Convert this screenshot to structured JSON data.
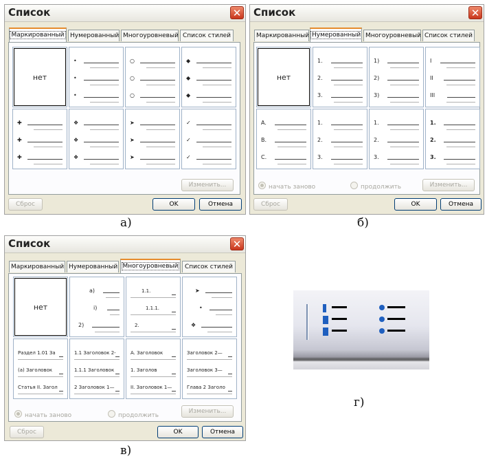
{
  "captions": {
    "a": "а)",
    "b": "б)",
    "v": "в)",
    "g": "г)"
  },
  "dialogs": [
    {
      "title": "Список",
      "tabs": [
        "Маркированный",
        "Нумерованный",
        "Многоуровневый",
        "Список стилей"
      ],
      "active_tab": 0,
      "cells": [
        {
          "none": "нет",
          "selected": true
        },
        {
          "markers": [
            "•",
            "•",
            "•"
          ]
        },
        {
          "markers": [
            "○",
            "○",
            "○"
          ]
        },
        {
          "markers": [
            "◆",
            "◆",
            "◆"
          ]
        },
        {
          "markers": [
            "✚",
            "✚",
            "✚"
          ]
        },
        {
          "markers": [
            "❖",
            "❖",
            "❖"
          ]
        },
        {
          "markers": [
            "➤",
            "➤",
            "➤"
          ]
        },
        {
          "markers": [
            "✓",
            "✓",
            "✓"
          ]
        }
      ],
      "change_label": "Изменить...",
      "reset_label": "Сброс",
      "ok_label": "OK",
      "cancel_label": "Отмена"
    },
    {
      "title": "Список",
      "tabs": [
        "Маркированный",
        "Нумерованный",
        "Многоуровневый",
        "Список стилей"
      ],
      "active_tab": 1,
      "cells": [
        {
          "none": "нет",
          "selected": true
        },
        {
          "markers": [
            "1.",
            "2.",
            "3."
          ]
        },
        {
          "markers": [
            "1)",
            "2)",
            "3)"
          ]
        },
        {
          "markers": [
            "I",
            "II",
            "III"
          ]
        },
        {
          "markers": [
            "A.",
            "B.",
            "C."
          ]
        },
        {
          "markers": [
            "1.",
            "2.",
            "3."
          ]
        },
        {
          "markers": [
            "1.",
            "2.",
            "3."
          ]
        },
        {
          "markers": [
            "1.",
            "2.",
            "3."
          ],
          "bold": true
        }
      ],
      "restart_label": "начать заново",
      "continue_label": "продолжить",
      "change_label": "Изменить...",
      "reset_label": "Сброс",
      "ok_label": "OK",
      "cancel_label": "Отмена"
    },
    {
      "title": "Список",
      "tabs": [
        "Маркированный",
        "Нумерованный",
        "Многоуровневый",
        "Список стилей"
      ],
      "active_tab": 2,
      "cells": [
        {
          "none": "нет",
          "selected": true
        },
        {
          "markers": [
            "a)",
            "i)",
            "2)"
          ],
          "indent": [
            22,
            28,
            6
          ]
        },
        {
          "markers": [
            "1.1.",
            "1.1.1.",
            "2."
          ],
          "indent": [
            16,
            22,
            6
          ]
        },
        {
          "markers": [
            "➤",
            "•",
            "❖"
          ],
          "indent": [
            12,
            18,
            6
          ]
        },
        {
          "markers": [
            "Раздел 1.01 За",
            "(a) Заголовок",
            "Статья II. Загол"
          ]
        },
        {
          "markers": [
            "1.1 Заголовок 2-",
            "1.1.1 Заголовок",
            "2 Заголовок 1—"
          ]
        },
        {
          "markers": [
            "A. Заголовок",
            "1. Заголов",
            "II. Заголовок 1—"
          ]
        },
        {
          "markers": [
            "Заголовок 2—",
            "Заголовок 3—",
            "Глава 2 Заголо"
          ]
        }
      ],
      "restart_label": "начать заново",
      "continue_label": "продолжить",
      "change_label": "Изменить...",
      "reset_label": "Сброс",
      "ok_label": "OK",
      "cancel_label": "Отмена"
    }
  ],
  "toolbar": {
    "buttons": [
      "numbering-icon",
      "bullets-icon"
    ],
    "accent": "#1f5fbf"
  }
}
